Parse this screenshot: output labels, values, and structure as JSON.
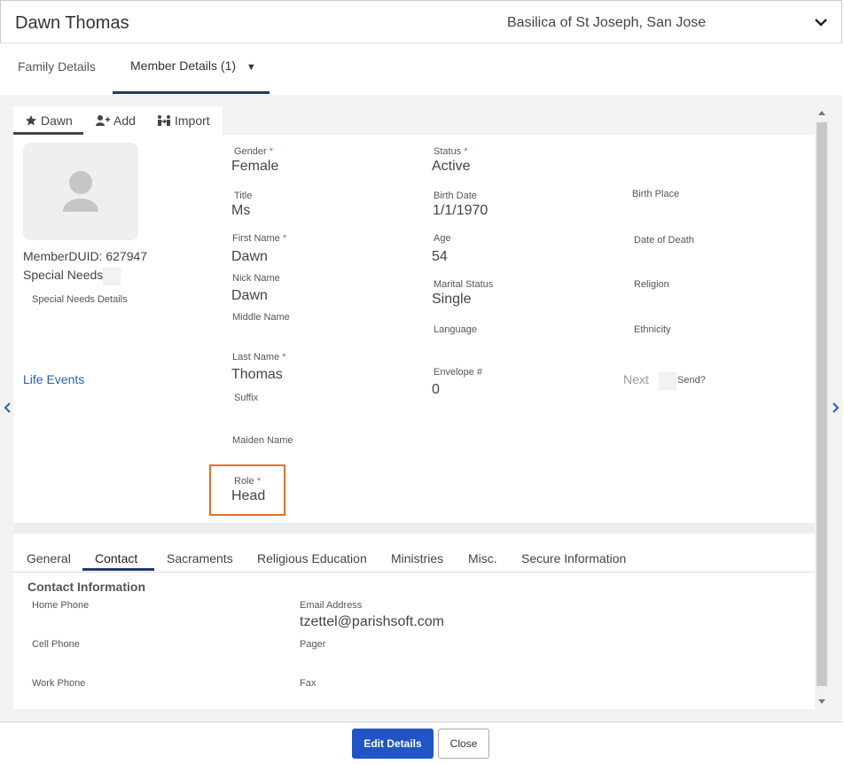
{
  "header": {
    "title": "Dawn Thomas",
    "parish": "Basilica of St Joseph, San Jose"
  },
  "top_tabs": {
    "family": "Family Details",
    "member": "Member Details (1)",
    "member_caret": "▼"
  },
  "sub_tabs": {
    "dawn": "Dawn",
    "add": "Add",
    "import": "Import"
  },
  "member": {
    "duid": "MemberDUID: 627947",
    "special_needs": "Special Needs",
    "special_needs_details": "Special Needs Details",
    "life_events": "Life Events"
  },
  "fields": {
    "gender": {
      "label": "Gender",
      "value": "Female"
    },
    "title": {
      "label": "Title",
      "value": "Ms"
    },
    "first_name": {
      "label": "First Name",
      "value": "Dawn"
    },
    "nick_name": {
      "label": "Nick Name",
      "value": "Dawn"
    },
    "middle_name": {
      "label": "Middle Name",
      "value": ""
    },
    "last_name": {
      "label": "Last Name",
      "value": "Thomas"
    },
    "suffix": {
      "label": "Suffix",
      "value": ""
    },
    "maiden_name": {
      "label": "Maiden Name",
      "value": ""
    },
    "role": {
      "label": "Role",
      "value": "Head"
    },
    "status": {
      "label": "Status",
      "value": "Active"
    },
    "birth_date": {
      "label": "Birth Date",
      "value": "1/1/1970"
    },
    "age": {
      "label": "Age",
      "value": "54"
    },
    "marital_status": {
      "label": "Marital Status",
      "value": "Single"
    },
    "language": {
      "label": "Language",
      "value": ""
    },
    "envelope": {
      "label": "Envelope #",
      "value": "0"
    },
    "birth_place": {
      "label": "Birth Place",
      "value": ""
    },
    "date_of_death": {
      "label": "Date of Death",
      "value": ""
    },
    "religion": {
      "label": "Religion",
      "value": ""
    },
    "ethnicity": {
      "label": "Ethnicity",
      "value": ""
    },
    "next": "Next",
    "send": "Send?"
  },
  "required_mark": "*",
  "bottom_tabs": [
    "General",
    "Contact",
    "Sacraments",
    "Religious Education",
    "Ministries",
    "Misc.",
    "Secure Information"
  ],
  "contact": {
    "section_title": "Contact Information",
    "home_phone": "Home Phone",
    "cell_phone": "Cell Phone",
    "work_phone": "Work Phone",
    "email_label": "Email Address",
    "email_value": "tzettel@parishsoft.com",
    "pager": "Pager",
    "fax": "Fax"
  },
  "footer": {
    "edit": "Edit Details",
    "close": "Close"
  },
  "colors": {
    "accent": "#2255c4",
    "link": "#2a5db0",
    "highlight": "#e8702a",
    "required": "#d9534f"
  }
}
